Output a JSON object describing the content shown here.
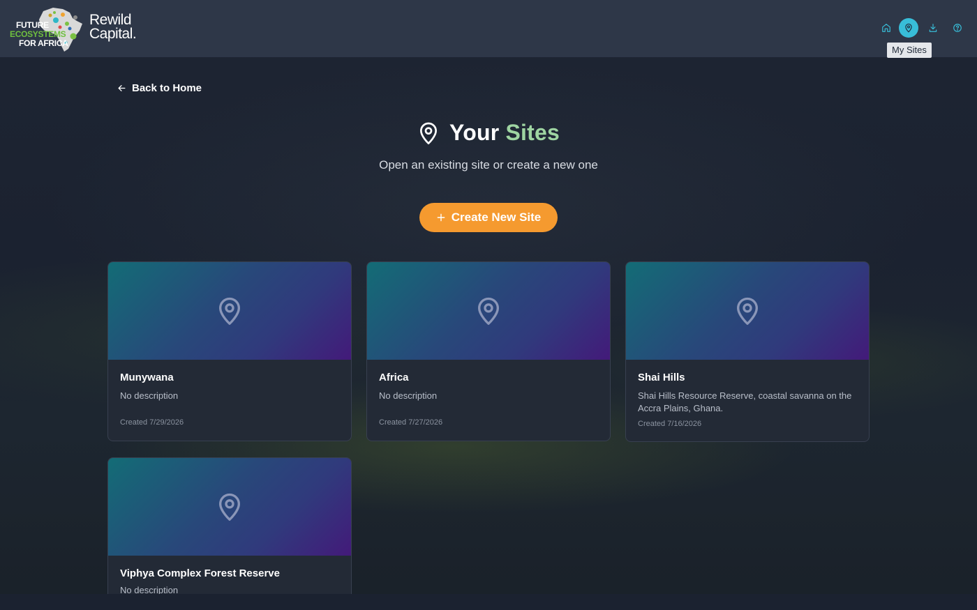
{
  "header": {
    "logo_lines": [
      "FUTURE",
      "ECOSYSTEMS",
      "FOR AFRICA"
    ],
    "brand_lines": [
      "Rewild",
      "Capital."
    ],
    "nav": [
      {
        "id": "home",
        "icon": "home-icon",
        "active": false
      },
      {
        "id": "sites",
        "icon": "map-pin-icon",
        "active": true
      },
      {
        "id": "download",
        "icon": "download-icon",
        "active": false
      },
      {
        "id": "help",
        "icon": "help-circle-icon",
        "active": false
      }
    ],
    "tooltip": "My Sites"
  },
  "main": {
    "back_label": "Back to Home",
    "title_part1": "Your",
    "title_part2": "Sites",
    "subtitle": "Open an existing site or create a new one",
    "create_label": "Create New Site"
  },
  "sites": [
    {
      "name": "Munywana",
      "description": "No description",
      "created": "Created 7/29/2026"
    },
    {
      "name": "Africa",
      "description": "No description",
      "created": "Created 7/27/2026"
    },
    {
      "name": "Shai Hills",
      "description": "Shai Hills Resource Reserve, coastal savanna on the Accra Plains, Ghana.",
      "created": "Created 7/16/2026"
    },
    {
      "name": "Viphya Complex Forest Reserve",
      "description": "No description",
      "created": ""
    }
  ],
  "colors": {
    "header_bg": "#2e3748",
    "accent_green": "#9fd5a2",
    "create_button": "#f59a2f",
    "active_nav": "#38bdd8"
  }
}
